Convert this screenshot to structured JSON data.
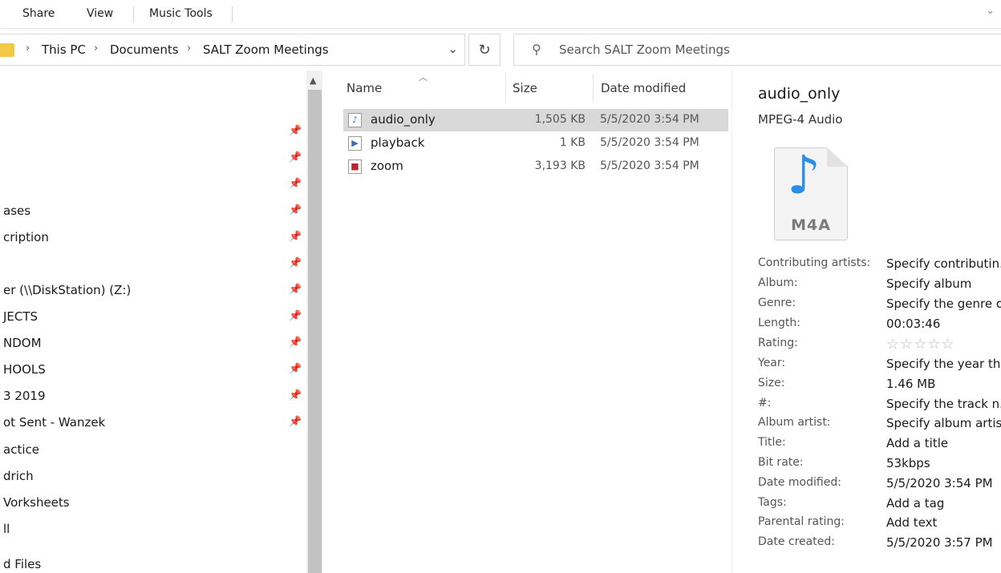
{
  "ribbon": {
    "tabs": [
      "Share",
      "View",
      "Music Tools"
    ]
  },
  "address": {
    "crumbs": [
      "This PC",
      "Documents",
      "SALT Zoom Meetings"
    ]
  },
  "search": {
    "placeholder": "Search SALT Zoom Meetings"
  },
  "nav": {
    "items": [
      "ases",
      "cription",
      "er (\\\\DiskStation) (Z:)",
      "JECTS",
      "NDOM",
      "HOOLS",
      "3 2019",
      "ot Sent - Wanzek",
      "actice",
      "drich",
      "Vorksheets",
      "ll",
      "d Files"
    ]
  },
  "columns": {
    "name": "Name",
    "size": "Size",
    "date": "Date modified"
  },
  "files": [
    {
      "name": "audio_only",
      "size": "1,505 KB",
      "date": "5/5/2020 3:54 PM",
      "icon": "audio-file-icon"
    },
    {
      "name": "playback",
      "size": "1 KB",
      "date": "5/5/2020 3:54 PM",
      "icon": "playlist-file-icon"
    },
    {
      "name": "zoom",
      "size": "3,193 KB",
      "date": "5/5/2020 3:54 PM",
      "icon": "video-file-icon"
    }
  ],
  "details": {
    "title": "audio_only",
    "type": "MPEG-4 Audio",
    "thumbnail_ext": "M4A",
    "rating_stars": "☆☆☆☆☆",
    "properties": [
      {
        "key": "Contributing artists:",
        "value": "Specify contributin..."
      },
      {
        "key": "Album:",
        "value": "Specify album"
      },
      {
        "key": "Genre:",
        "value": "Specify the genre o..."
      },
      {
        "key": "Length:",
        "value": "00:03:46"
      },
      {
        "key": "Rating:",
        "value": ""
      },
      {
        "key": "Year:",
        "value": "Specify the year thi..."
      },
      {
        "key": "Size:",
        "value": "1.46 MB"
      },
      {
        "key": "#:",
        "value": "Specify the track n..."
      },
      {
        "key": "Album artist:",
        "value": "Specify album artist"
      },
      {
        "key": "Title:",
        "value": "Add a title"
      },
      {
        "key": "Bit rate:",
        "value": "53kbps"
      },
      {
        "key": "Date modified:",
        "value": "5/5/2020 3:54 PM"
      },
      {
        "key": "Tags:",
        "value": "Add a tag"
      },
      {
        "key": "Parental rating:",
        "value": "Add text"
      },
      {
        "key": "Date created:",
        "value": "5/5/2020 3:57 PM"
      }
    ]
  },
  "colors": {
    "selected_row": "#d9d9d9",
    "folder": "#f3c845",
    "audio_note": "#2b8ee8"
  }
}
